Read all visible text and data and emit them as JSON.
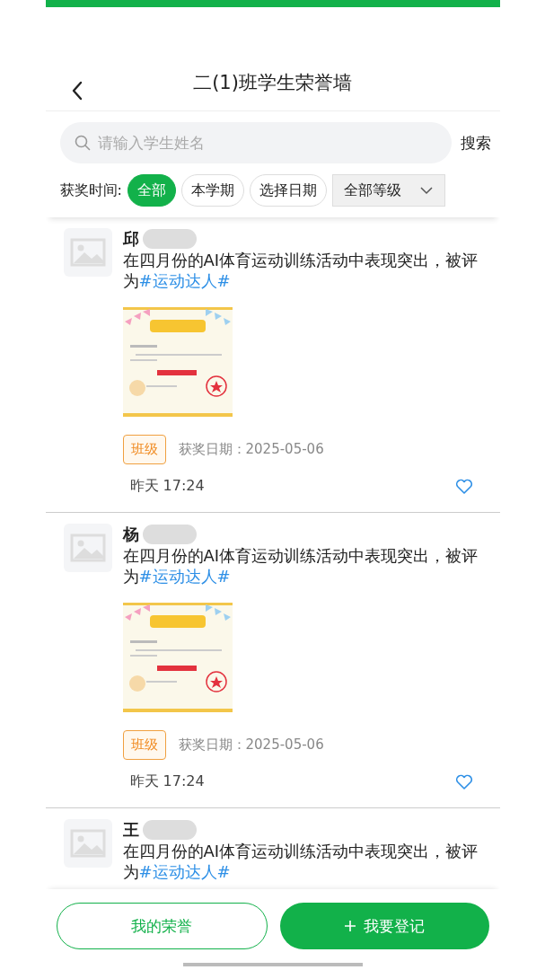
{
  "header": {
    "title": "二(1)班学生荣誉墙"
  },
  "search": {
    "placeholder": "请输入学生姓名",
    "button": "搜索"
  },
  "filters": {
    "label": "获奖时间:",
    "chips": [
      {
        "label": "全部",
        "selected": true
      },
      {
        "label": "本学期",
        "selected": false
      },
      {
        "label": "选择日期",
        "selected": false
      }
    ],
    "level_dropdown": "全部等级"
  },
  "posts": [
    {
      "name": "邱",
      "text": "在四月份的AI体育运动训练活动中表现突出，被评为",
      "tag": "#运动达人#",
      "badge": "班级",
      "date": "获奖日期：2025-05-06",
      "time": "昨天 17:24",
      "liked": false
    },
    {
      "name": "杨",
      "text": "在四月份的AI体育运动训练活动中表现突出，被评为",
      "tag": "#运动达人#",
      "badge": "班级",
      "date": "获奖日期：2025-05-06",
      "time": "昨天 17:24",
      "liked": false
    },
    {
      "name": "王",
      "text": "在四月份的AI体育运动训练活动中表现突出，被评为",
      "tag": "#运动达人#"
    }
  ],
  "bottom_bar": {
    "buttons": [
      {
        "label": "我的荣誉",
        "kind": "outline"
      },
      {
        "label": "我要登记",
        "kind": "primary"
      }
    ]
  }
}
